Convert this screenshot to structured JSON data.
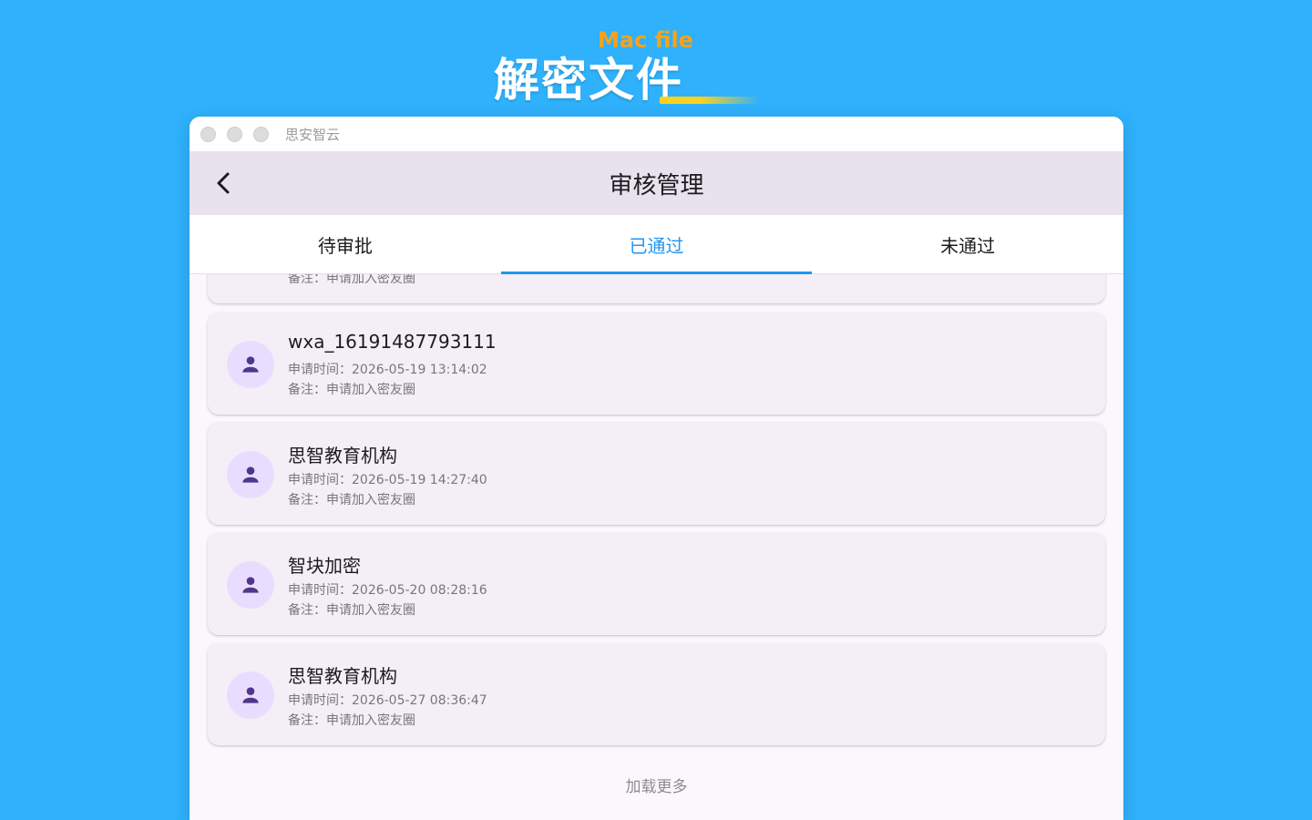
{
  "promo": {
    "subtitle": "Mac file",
    "title": "解密文件"
  },
  "window": {
    "title": "思安智云"
  },
  "appbar": {
    "title": "审核管理"
  },
  "tabs": [
    {
      "label": "待审批"
    },
    {
      "label": "已通过"
    },
    {
      "label": "未通过"
    }
  ],
  "active_tab": "已通过",
  "partial_card": {
    "note": "备注：申请加入密友圈"
  },
  "items": [
    {
      "name": "wxa_16191487793111",
      "time": "申请时间：2026-05-19 13:14:02",
      "note": "备注：申请加入密友圈"
    },
    {
      "name": "思智教育机构",
      "time": "申请时间：2026-05-19 14:27:40",
      "note": "备注：申请加入密友圈"
    },
    {
      "name": "智块加密",
      "time": "申请时间：2026-05-20 08:28:16",
      "note": "备注：申请加入密友圈"
    },
    {
      "name": "思智教育机构",
      "time": "申请时间：2026-05-27 08:36:47",
      "note": "备注：申请加入密友圈"
    }
  ],
  "load_more": "加载更多",
  "colors": {
    "background": "#2fb1fc",
    "accent": "#2196f3",
    "avatar_bg": "#e9ddff",
    "avatar_icon": "#4f378b"
  },
  "icons": {
    "back": "chevron-left-icon",
    "avatar": "person-icon"
  }
}
